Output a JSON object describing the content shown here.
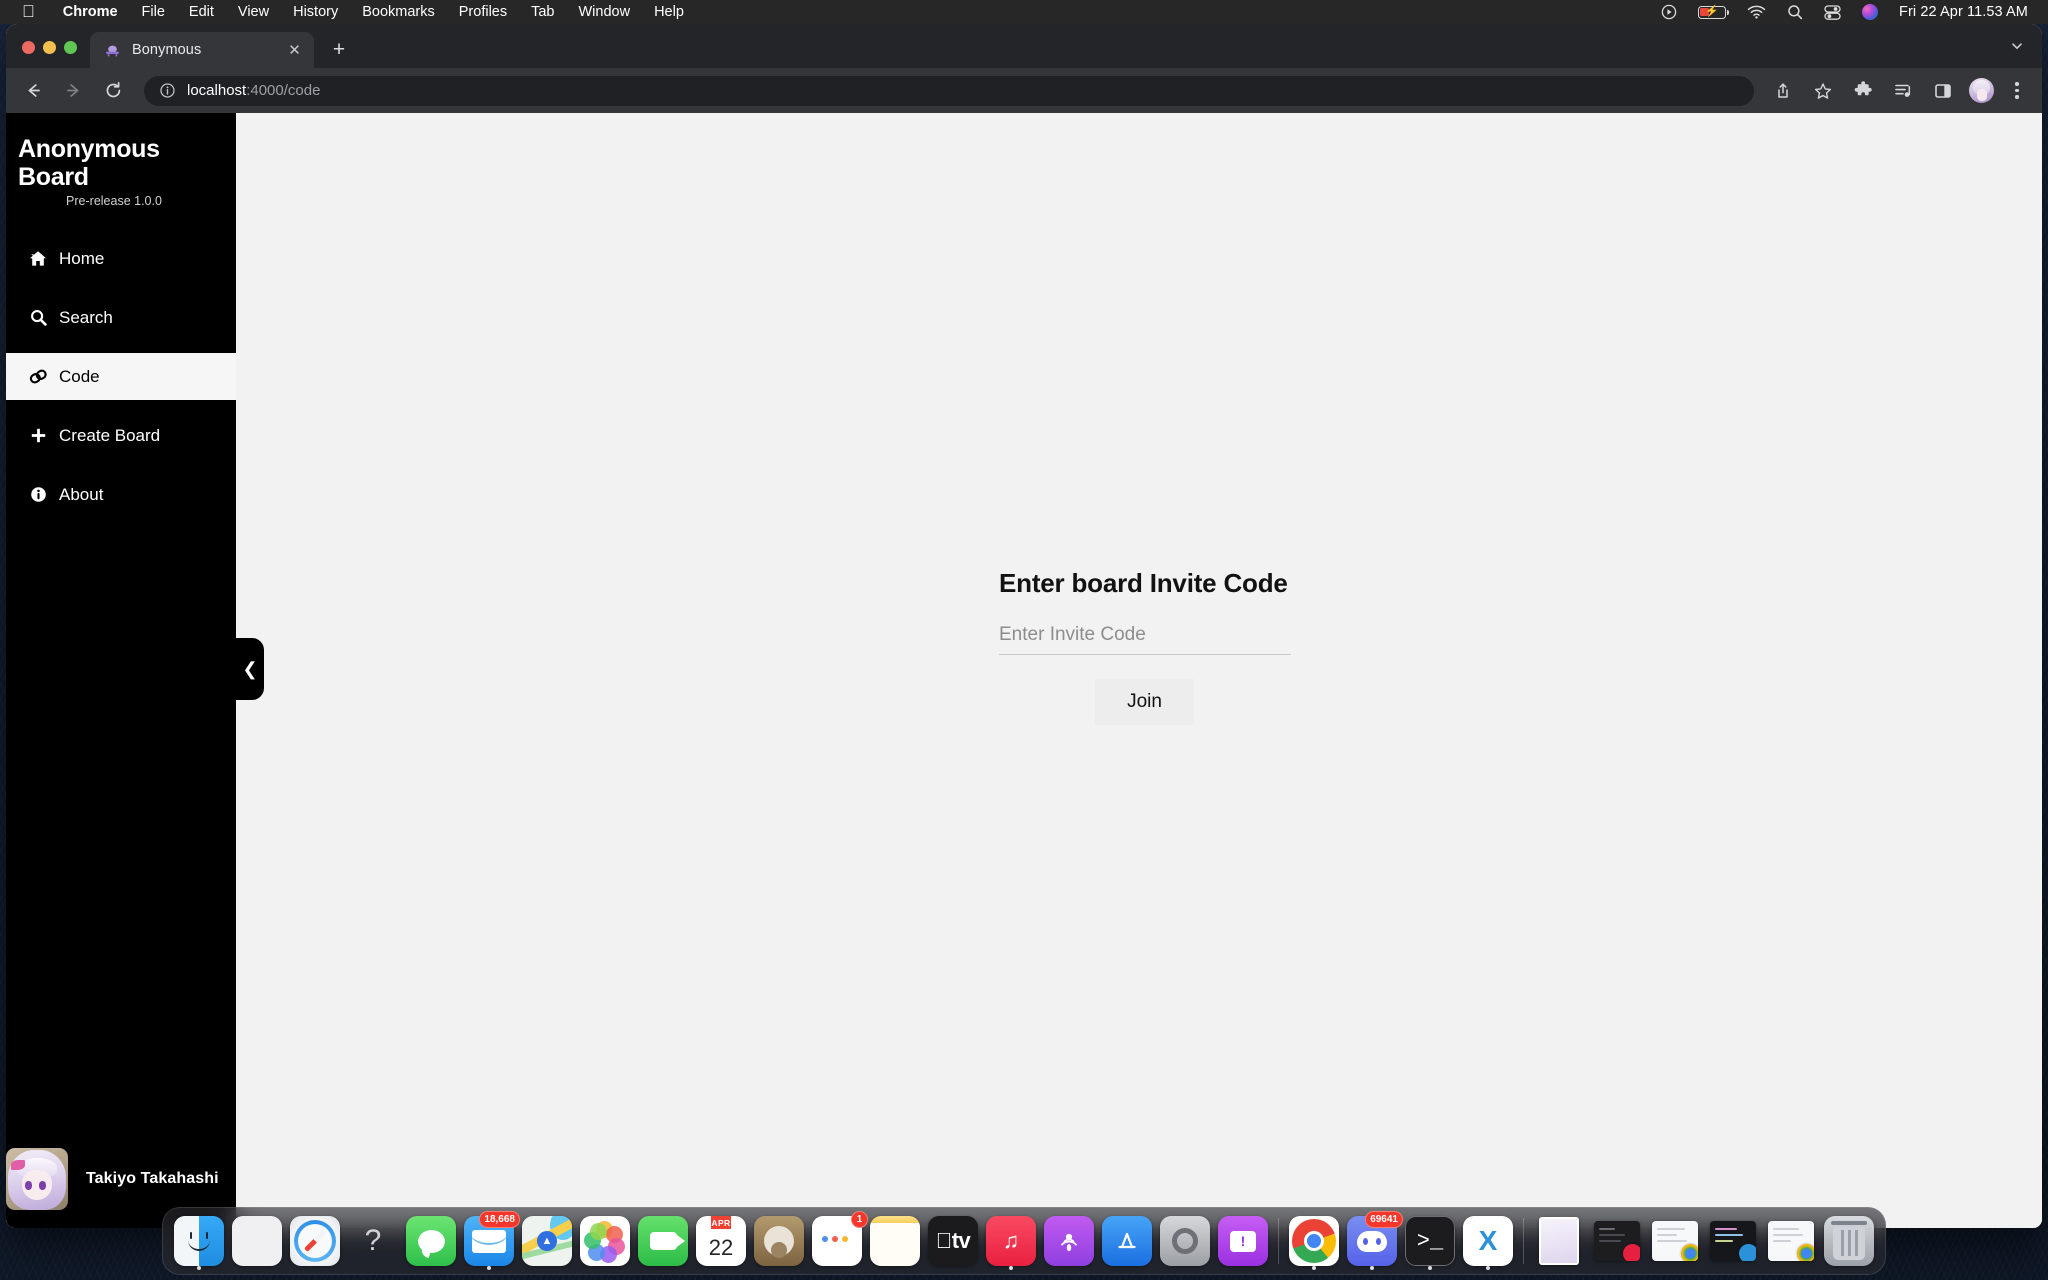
{
  "menubar": {
    "apple_glyph": "",
    "items": [
      {
        "label": "Chrome",
        "bold": true
      },
      {
        "label": "File",
        "bold": false
      },
      {
        "label": "Edit",
        "bold": false
      },
      {
        "label": "View",
        "bold": false
      },
      {
        "label": "History",
        "bold": false
      },
      {
        "label": "Bookmarks",
        "bold": false
      },
      {
        "label": "Profiles",
        "bold": false
      },
      {
        "label": "Tab",
        "bold": false
      },
      {
        "label": "Window",
        "bold": false
      },
      {
        "label": "Help",
        "bold": false
      }
    ],
    "status_icons": [
      "screen-record-icon",
      "battery-icon",
      "wifi-icon",
      "spotlight-search-icon",
      "control-center-icon",
      "siri-icon"
    ],
    "clock": "Fri 22 Apr  11.53 AM"
  },
  "browser": {
    "tab": {
      "title": "Bonymous",
      "favicon": "bonymous-favicon",
      "close_glyph": "✕"
    },
    "new_tab_glyph": "+",
    "tab_search_glyph": "⌄",
    "toolbar": {
      "back_glyph": "←",
      "forward_glyph": "→",
      "reload_glyph": "↻",
      "omnibox": {
        "host": "localhost",
        "path": ":4000/code",
        "info_icon": "site-info-icon"
      },
      "right_icons": [
        "share-icon",
        "bookmark-star-icon",
        "extensions-puzzle-icon",
        "media-playlist-icon",
        "side-panel-icon",
        "profile-avatar-icon",
        "chrome-menu-kebab-icon"
      ]
    }
  },
  "sidebar": {
    "title": "Anonymous Board",
    "subtitle": "Pre-release 1.0.0",
    "items": [
      {
        "label": "Home",
        "icon": "home-icon",
        "active": false
      },
      {
        "label": "Search",
        "icon": "search-icon",
        "active": false
      },
      {
        "label": "Code",
        "icon": "link-icon",
        "active": true
      },
      {
        "label": "Create Board",
        "icon": "plus-icon",
        "active": false
      },
      {
        "label": "About",
        "icon": "info-circle-icon",
        "active": false
      }
    ],
    "user": {
      "name": "Takiyo Takahashi",
      "avatar": "anime-avatar"
    },
    "collapse_glyph": "❮",
    "colors": {
      "background": "#000000",
      "active_background": "#f6f6f6",
      "text": "#ffffff"
    }
  },
  "main": {
    "heading": "Enter board Invite Code",
    "input_placeholder": "Enter Invite Code",
    "input_value": "",
    "join_label": "Join",
    "colors": {
      "page_background": "#f2f2f2",
      "button_background": "#ededed"
    }
  },
  "dock": {
    "apps": [
      {
        "name": "finder",
        "running": true
      },
      {
        "name": "launchpad",
        "running": false
      },
      {
        "name": "safari",
        "running": false
      },
      {
        "name": "question-mark-app",
        "running": false,
        "glyph": "?"
      },
      {
        "name": "messages",
        "running": false
      },
      {
        "name": "mail",
        "running": true,
        "badge": "18,668"
      },
      {
        "name": "maps",
        "running": false
      },
      {
        "name": "photos",
        "running": false
      },
      {
        "name": "facetime",
        "running": false
      },
      {
        "name": "calendar",
        "running": false,
        "month": "APR",
        "day": "22"
      },
      {
        "name": "contacts",
        "running": false
      },
      {
        "name": "reminders",
        "running": false,
        "badge": "1"
      },
      {
        "name": "notes",
        "running": false
      },
      {
        "name": "apple-tv",
        "running": false,
        "glyph": "tv"
      },
      {
        "name": "music",
        "running": true,
        "glyph": "♫"
      },
      {
        "name": "podcasts",
        "running": false
      },
      {
        "name": "app-store",
        "running": false,
        "glyph": "A"
      },
      {
        "name": "system-preferences",
        "running": false
      },
      {
        "name": "chat-app",
        "running": false,
        "glyph": "!"
      }
    ],
    "apps2": [
      {
        "name": "chrome",
        "running": true
      },
      {
        "name": "discord",
        "running": true,
        "badge": "69641"
      },
      {
        "name": "terminal",
        "running": true,
        "glyph": ">_"
      },
      {
        "name": "vscode",
        "running": true,
        "glyph": "X"
      }
    ],
    "minimized": [
      "minimized-window-anime",
      "minimized-window-music",
      "minimized-window-chrome-1",
      "minimized-window-vscode",
      "minimized-window-chrome-2"
    ],
    "trash": "trash-icon"
  }
}
